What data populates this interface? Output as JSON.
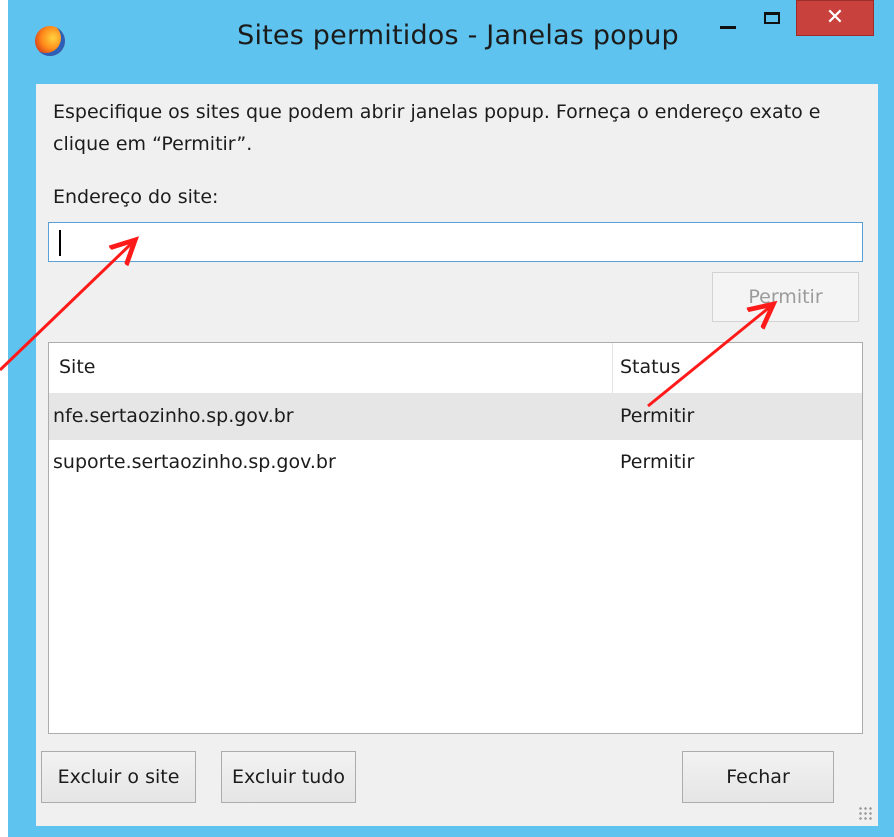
{
  "window": {
    "title": "Sites permitidos - Janelas popup",
    "icon": "firefox-icon",
    "controls": {
      "minimize_icon": "minimize-icon",
      "maximize_icon": "maximize-icon",
      "close_glyph": "✕"
    }
  },
  "dialog": {
    "description": "Especifique os sites que podem abrir janelas popup. Forneça o endereço exato e clique em “Permitir”.",
    "address_label": "Endereço do site:",
    "address_value": "",
    "permit_button": "Permitir",
    "permit_enabled": false
  },
  "sites_table": {
    "columns": [
      "Site",
      "Status"
    ],
    "rows": [
      {
        "site": "nfe.sertaozinho.sp.gov.br",
        "status": "Permitir",
        "selected": true
      },
      {
        "site": "suporte.sertaozinho.sp.gov.br",
        "status": "Permitir",
        "selected": false
      }
    ]
  },
  "buttons": {
    "remove_site": "Excluir o site",
    "remove_all": "Excluir tudo",
    "close": "Fechar"
  },
  "annotation_color": "#ff1a1a",
  "colors": {
    "titlebar": "#5ec3ef",
    "close_button": "#c9413d",
    "input_border": "#5a9fd6",
    "selected_row": "#e6e6e6"
  }
}
